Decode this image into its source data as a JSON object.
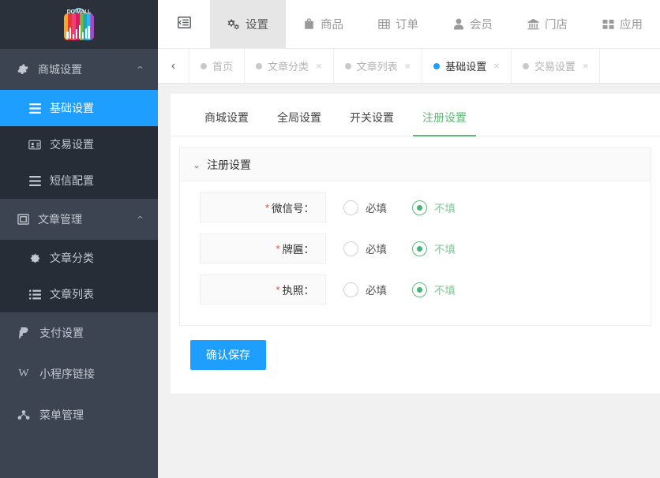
{
  "brand": {
    "logo_text": "DC-MALL",
    "logo_icon": "shopping-bag-chart-logo"
  },
  "sidebar": {
    "groups": [
      {
        "icon": "gear-icon",
        "label": "商城设置",
        "expanded": true,
        "chevron": "chevron-up-icon",
        "items": [
          {
            "icon": "list-icon",
            "label": "基础设置",
            "active": true
          },
          {
            "icon": "id-card-icon",
            "label": "交易设置",
            "active": false
          },
          {
            "icon": "list-icon",
            "label": "短信配置",
            "active": false
          }
        ]
      },
      {
        "icon": "window-icon",
        "label": "文章管理",
        "expanded": true,
        "chevron": "chevron-up-icon",
        "items": [
          {
            "icon": "asterisk-icon",
            "label": "文章分类",
            "active": false
          },
          {
            "icon": "list-ul-icon",
            "label": "文章列表",
            "active": false
          }
        ]
      }
    ],
    "links": [
      {
        "icon": "paypal-icon",
        "glyph": "P",
        "label": "支付设置"
      },
      {
        "icon": "weixin-w-icon",
        "glyph": "W",
        "label": "小程序链接"
      },
      {
        "icon": "sitemap-icon",
        "glyph": "☸",
        "label": "菜单管理"
      }
    ]
  },
  "topnav": {
    "collapse_icon": "menu-fold-icon",
    "items": [
      {
        "icon": "gears-icon",
        "label": "设置",
        "active": true
      },
      {
        "icon": "bag-icon",
        "label": "商品",
        "active": false
      },
      {
        "icon": "table-icon",
        "label": "订单",
        "active": false
      },
      {
        "icon": "user-icon",
        "label": "会员",
        "active": false
      },
      {
        "icon": "bank-icon",
        "label": "门店",
        "active": false
      },
      {
        "icon": "grid-icon",
        "label": "应用",
        "active": false
      }
    ]
  },
  "tabbar": {
    "prev_icon": "chevron-left-icon",
    "tabs": [
      {
        "label": "首页",
        "active": false,
        "closable": false
      },
      {
        "label": "文章分类",
        "active": false,
        "closable": true
      },
      {
        "label": "文章列表",
        "active": false,
        "closable": true
      },
      {
        "label": "基础设置",
        "active": true,
        "closable": true
      },
      {
        "label": "交易设置",
        "active": false,
        "closable": true
      }
    ],
    "close_glyph": "×"
  },
  "page": {
    "subtabs": [
      {
        "label": "商城设置",
        "active": false
      },
      {
        "label": "全局设置",
        "active": false
      },
      {
        "label": "开关设置",
        "active": false
      },
      {
        "label": "注册设置",
        "active": true
      }
    ],
    "fieldset": {
      "collapse_icon": "chevron-down-icon",
      "legend": "注册设置",
      "rows": [
        {
          "required_mark": "*",
          "label": "微信号：",
          "options": [
            {
              "label": "必填",
              "checked": false
            },
            {
              "label": "不填",
              "checked": true
            }
          ]
        },
        {
          "required_mark": "*",
          "label": "牌匾：",
          "options": [
            {
              "label": "必填",
              "checked": false
            },
            {
              "label": "不填",
              "checked": true
            }
          ]
        },
        {
          "required_mark": "*",
          "label": "执照：",
          "options": [
            {
              "label": "必填",
              "checked": false
            },
            {
              "label": "不填",
              "checked": true
            }
          ]
        }
      ]
    },
    "submit_label": "确认保存"
  },
  "colors": {
    "sidebar_bg": "#3b4450",
    "sidebar_sub_bg": "#272d36",
    "sidebar_logo_bg": "#2b313a",
    "accent_blue": "#1e9fff",
    "accent_green": "#5fb878",
    "required_red": "#e54d42",
    "page_bg": "#f1f1f1"
  }
}
